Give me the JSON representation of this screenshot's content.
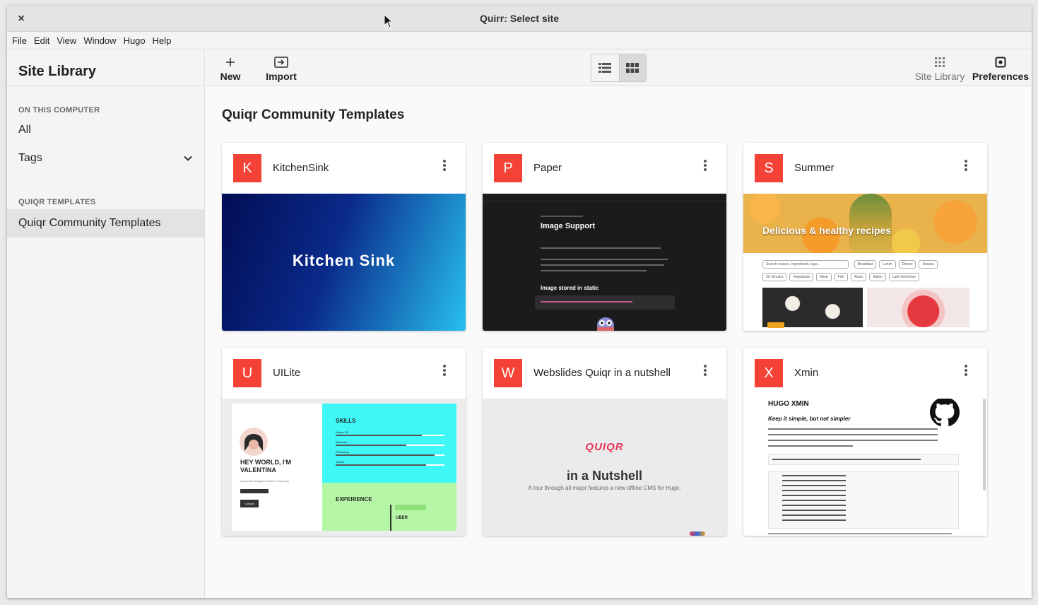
{
  "window": {
    "title": "Quirr: Select site",
    "close_glyph": "×"
  },
  "menu": [
    "File",
    "Edit",
    "View",
    "Window",
    "Hugo",
    "Help"
  ],
  "sidebar": {
    "title": "Site Library",
    "sections": [
      {
        "heading": "ON THIS COMPUTER",
        "items": [
          {
            "label": "All"
          },
          {
            "label": "Tags",
            "icon": "chevron-down-icon"
          }
        ]
      },
      {
        "heading": "QUIQR TEMPLATES",
        "items": [
          {
            "label": "Quiqr Community Templates",
            "selected": true
          }
        ]
      }
    ]
  },
  "toolbar": {
    "new_label": "New",
    "new_icon": "plus-icon",
    "import_label": "Import",
    "import_icon": "import-icon",
    "view_list_icon": "list-view-icon",
    "view_grid_icon": "grid-view-icon",
    "view_active": "grid",
    "site_library_label": "Site Library",
    "site_library_icon": "apps-icon",
    "preferences_label": "Preferences",
    "preferences_icon": "settings-icon"
  },
  "main": {
    "heading": "Quiqr Community Templates",
    "cards": [
      {
        "letter": "K",
        "name": "KitchenSink",
        "preview": {
          "title": "Kitchen Sink"
        }
      },
      {
        "letter": "P",
        "name": "Paper",
        "preview": {
          "heading": "Image Support",
          "subheading": "Image stored in static"
        }
      },
      {
        "letter": "S",
        "name": "Summer",
        "preview": {
          "title": "Delicious & healthy recipes",
          "search_placeholder": "Search recipes, ingredients, tags...",
          "tags": [
            "Breakfast",
            "Lunch",
            "Dinner",
            "Snacks",
            "20 minutes",
            "Vegetarian",
            "Meat",
            "Fish",
            "Asian",
            "Italian",
            "Latin American"
          ]
        }
      },
      {
        "letter": "U",
        "name": "UILite",
        "preview": {
          "hero": "HEY WORLD, I'M VALENTINA",
          "tagline": "A graphics designer based in Germany",
          "button": "Contact",
          "skills_title": "SKILLS",
          "skills": [
            "Adobe XD",
            "Illustrator",
            "Photoshop",
            "Sketch"
          ],
          "experience_title": "EXPERIENCE",
          "company": "UBER"
        }
      },
      {
        "letter": "W",
        "name": "Webslides Quiqr in a nutshell",
        "preview": {
          "logo": "QUIQR",
          "title": "in a Nutshell",
          "subtitle": "A tour through all major features a new offline CMS for Hugo."
        }
      },
      {
        "letter": "X",
        "name": "Xmin",
        "preview": {
          "title": "HUGO XMIN",
          "subtitle": "Keep it simple, but not simpler"
        }
      }
    ]
  },
  "colors": {
    "avatar": "#f44336",
    "sidebar_bg": "#f4f4f4",
    "selected_bg": "#e3e3e3",
    "kitchen_from": "#020d54",
    "kitchen_to": "#27c0ef"
  }
}
